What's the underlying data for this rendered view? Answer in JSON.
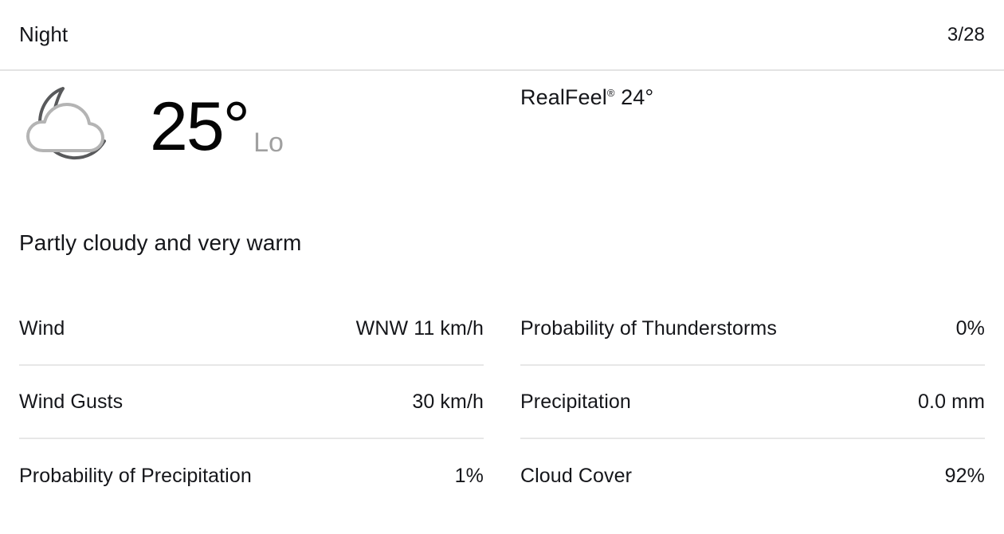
{
  "header": {
    "period_label": "Night",
    "date": "3/28"
  },
  "conditions": {
    "icon": "moon-cloud-icon",
    "temperature": "25°",
    "temperature_qualifier": "Lo",
    "realfeel_label": "RealFeel",
    "realfeel_trademark": "®",
    "realfeel_value": "24°",
    "phrase": "Partly cloudy and very warm"
  },
  "details": {
    "left_column": [
      {
        "label": "Wind",
        "value": "WNW 11 km/h"
      },
      {
        "label": "Wind Gusts",
        "value": "30 km/h"
      },
      {
        "label": "Probability of Precipitation",
        "value": "1%"
      }
    ],
    "right_column": [
      {
        "label": "Probability of Thunderstorms",
        "value": "0%"
      },
      {
        "label": "Precipitation",
        "value": "0.0 mm"
      },
      {
        "label": "Cloud Cover",
        "value": "92%"
      }
    ]
  },
  "colors": {
    "text": "#15161a",
    "muted": "#a0a0a0",
    "divider": "#e7e7e7",
    "moon_stroke": "#58595b",
    "cloud_stroke": "#b4b4b4",
    "background": "#ffffff"
  }
}
